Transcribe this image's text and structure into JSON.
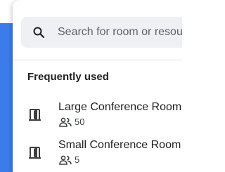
{
  "search": {
    "placeholder": "Search for room or resource"
  },
  "frequent": {
    "heading": "Frequently used",
    "rooms": [
      {
        "name": "Large Conference Room",
        "capacity": "50",
        "icon": "room-door-icon"
      },
      {
        "name": "Small Conference Room",
        "capacity": "5",
        "icon": "room-door-icon"
      }
    ]
  },
  "colors": {
    "accent": "#3b7bea",
    "search_bg": "#eef0f3",
    "text": "#202124",
    "secondary_text": "#5f6368",
    "divider": "#dadce0"
  }
}
